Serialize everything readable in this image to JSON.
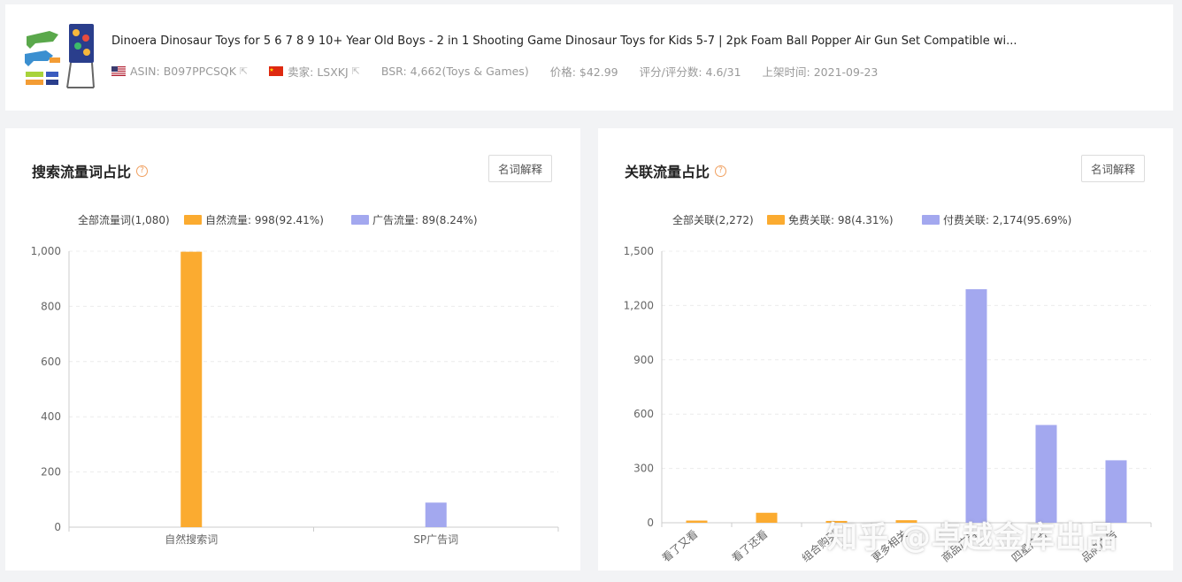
{
  "product": {
    "title": "Dinoera Dinosaur Toys for 5 6 7 8 9 10+ Year Old Boys - 2 in 1 Shooting Game Dinosaur Toys for Kids 5-7 | 2pk Foam Ball Popper Air Gun Set Compatible wi...",
    "asin": "ASIN: B097PPCSQK",
    "seller": "卖家: LSXKJ",
    "bsr": "BSR: 4,662(Toys & Games)",
    "price": "价格: $42.99",
    "rating": "评分/评分数: 4.6/31",
    "listed": "上架时间: 2021-09-23"
  },
  "search_panel": {
    "title": "搜索流量词占比",
    "glossary": "名词解释",
    "legend_total": "全部流量词(1,080)",
    "legend_organic": "自然流量: 998(92.41%)",
    "legend_ad": "广告流量: 89(8.24%)"
  },
  "related_panel": {
    "title": "关联流量占比",
    "glossary": "名词解释",
    "legend_total": "全部关联(2,272)",
    "legend_free": "免费关联: 98(4.31%)",
    "legend_paid": "付费关联: 2,174(95.69%)"
  },
  "watermark": "知乎 @卓越金库出品",
  "colors": {
    "organic": "#fbab30",
    "ad": "#a3a8ef",
    "grid": "#ececec"
  },
  "chart_data": [
    {
      "type": "bar",
      "categories": [
        "自然搜索词",
        "SP广告词"
      ],
      "series": [
        {
          "name": "自然流量",
          "values": [
            998,
            0
          ]
        },
        {
          "name": "广告流量",
          "values": [
            0,
            89
          ]
        }
      ],
      "yticks": [
        "0",
        "200",
        "400",
        "600",
        "800",
        "1,000"
      ],
      "ylim": [
        0,
        1000
      ],
      "grid": true,
      "legend": "top"
    },
    {
      "type": "bar",
      "categories": [
        "看了又看",
        "看了还看",
        "组合购买",
        "更多相关",
        "商品广告",
        "四星广告",
        "品牌广告"
      ],
      "series": [
        {
          "name": "免费关联",
          "values": [
            12,
            55,
            10,
            14,
            0,
            0,
            0
          ]
        },
        {
          "name": "付费关联",
          "values": [
            0,
            0,
            0,
            0,
            1290,
            540,
            345
          ]
        }
      ],
      "yticks": [
        "0",
        "300",
        "600",
        "900",
        "1,200",
        "1,500"
      ],
      "ylim": [
        0,
        1500
      ],
      "grid": true,
      "legend": "top"
    }
  ]
}
